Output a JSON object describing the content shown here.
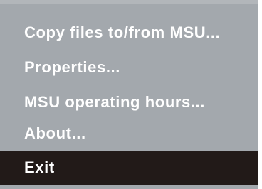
{
  "context_menu": {
    "items": [
      {
        "label": "Copy files to/from MSU...",
        "selected": false
      },
      {
        "label": "Properties...",
        "selected": false
      },
      {
        "label": "MSU operating hours...",
        "selected": false
      },
      {
        "label": "About...",
        "selected": false
      },
      {
        "label": "Exit",
        "selected": true
      }
    ]
  },
  "colors": {
    "menu_background": "#a3a8ad",
    "selected_background": "#221a18",
    "text": "#ffffff"
  }
}
